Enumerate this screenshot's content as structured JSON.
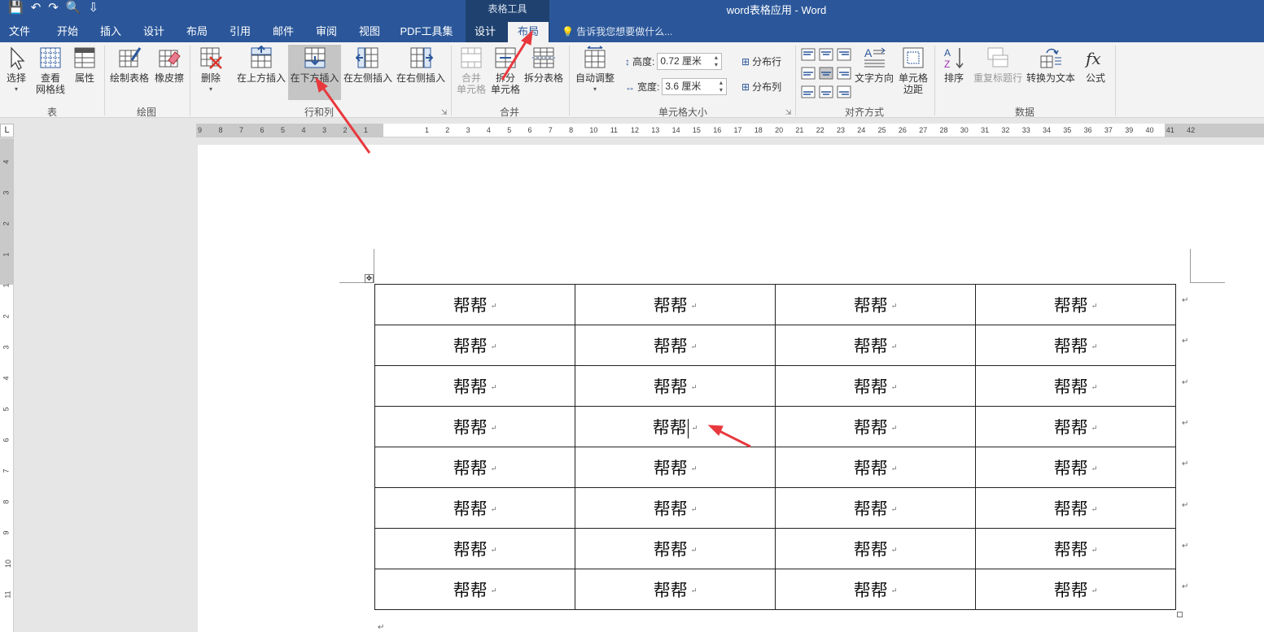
{
  "window": {
    "title": "word表格应用 - Word",
    "context_group": "表格工具",
    "qat": [
      "💾",
      "↶",
      "↷",
      "🔍",
      "⇩"
    ]
  },
  "tabs": [
    "文件",
    "开始",
    "插入",
    "设计",
    "布局",
    "引用",
    "邮件",
    "审阅",
    "视图",
    "PDF工具集",
    "设计",
    "布局"
  ],
  "tell_me": "告诉我您想要做什么...",
  "ribbon": {
    "select": "选择",
    "view_gridlines_1": "查看",
    "view_gridlines_2": "网格线",
    "properties": "属性",
    "draw_table": "绘制表格",
    "eraser": "橡皮擦",
    "delete": "删除",
    "insert_above": "在上方插入",
    "insert_below": "在下方插入",
    "insert_left": "在左侧插入",
    "insert_right": "在右侧插入",
    "merge_cells_1": "合并",
    "merge_cells_2": "单元格",
    "split_cells_1": "拆分",
    "split_cells_2": "单元格",
    "split_table": "拆分表格",
    "autofit": "自动调整",
    "height_label": "高度:",
    "height_value": "0.72 厘米",
    "width_label": "宽度:",
    "width_value": "3.6 厘米",
    "distribute_rows": "分布行",
    "distribute_cols": "分布列",
    "text_direction": "文字方向",
    "cell_margins_1": "单元格",
    "cell_margins_2": "边距",
    "sort": "排序",
    "repeat_header": "重复标题行",
    "convert_to_text": "转换为文本",
    "formula": "公式",
    "groups": {
      "table": "表",
      "draw": "绘图",
      "rows_cols": "行和列",
      "merge": "合并",
      "cell_size": "单元格大小",
      "alignment": "对齐方式",
      "data": "数据"
    }
  },
  "ruler": {
    "corner": "L",
    "left_ticks": [
      "9",
      "8",
      "7",
      "6",
      "5",
      "4",
      "3",
      "2",
      "1"
    ],
    "right_ticks": [
      "1",
      "2",
      "3",
      "4",
      "5",
      "6",
      "7",
      "8",
      "10",
      "11",
      "12",
      "13",
      "14",
      "15",
      "16",
      "17",
      "18",
      "20",
      "21",
      "22",
      "23",
      "24",
      "25",
      "26",
      "27",
      "28",
      "30",
      "31",
      "32",
      "33",
      "34",
      "35",
      "36",
      "37",
      "39",
      "40",
      "41",
      "42"
    ],
    "vertical_ticks": [
      "4",
      "3",
      "2",
      "1",
      "1",
      "2",
      "3",
      "4",
      "5",
      "6",
      "7",
      "8",
      "9",
      "10",
      "11"
    ]
  },
  "table": {
    "rows": [
      [
        "帮帮",
        "帮帮",
        "帮帮",
        "帮帮"
      ],
      [
        "帮帮",
        "帮帮",
        "帮帮",
        "帮帮"
      ],
      [
        "帮帮",
        "帮帮",
        "帮帮",
        "帮帮"
      ],
      [
        "帮帮",
        "帮帮",
        "帮帮",
        "帮帮"
      ],
      [
        "帮帮",
        "帮帮",
        "帮帮",
        "帮帮"
      ],
      [
        "帮帮",
        "帮帮",
        "帮帮",
        "帮帮"
      ],
      [
        "帮帮",
        "帮帮",
        "帮帮",
        "帮帮"
      ],
      [
        "帮帮",
        "帮帮",
        "帮帮",
        "帮帮"
      ]
    ],
    "cursor_cell": [
      3,
      1
    ],
    "para_mark": "↵",
    "move_handle": "✥"
  },
  "colors": {
    "title_bar": "#2b579a",
    "context_band": "#1e416f",
    "annotation_arrow": "#e8383d"
  }
}
